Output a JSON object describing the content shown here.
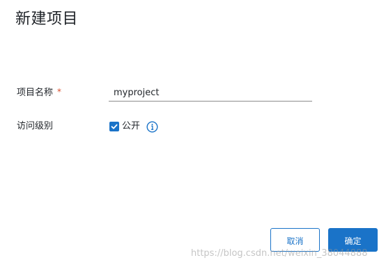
{
  "dialog": {
    "title": "新建项目"
  },
  "form": {
    "name_label": "项目名称",
    "required_mark": "*",
    "name_value": "myproject",
    "visibility_label": "访问级别",
    "public_label": "公开",
    "public_checked": true
  },
  "buttons": {
    "cancel": "取消",
    "ok": "确定"
  },
  "watermark": "https://blog.csdn.net/weixin_38044888",
  "colors": {
    "accent": "#1a73c8",
    "required": "#d94f2d"
  },
  "icons": {
    "checkbox": "checkmark-icon",
    "info": "info-icon"
  }
}
